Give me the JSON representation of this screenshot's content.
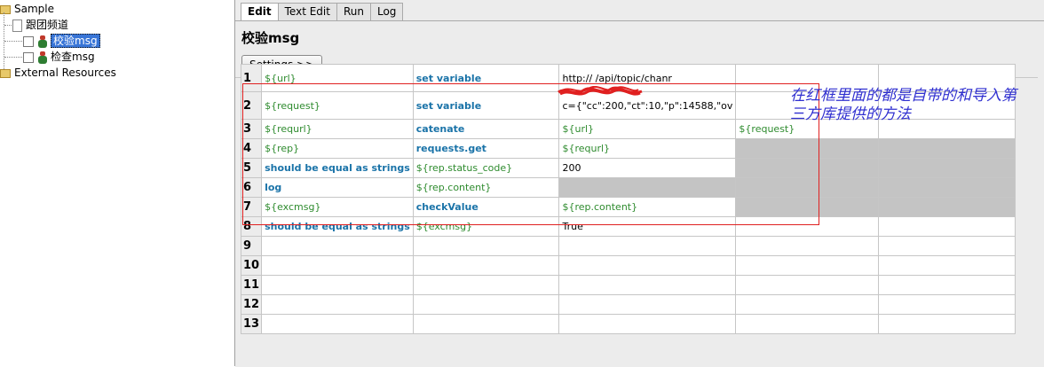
{
  "tree": {
    "root_label": "Sample",
    "suite_label": "跟团频道",
    "test1_label": "校验msg",
    "test2_label": "检查msg",
    "resources_label": "External Resources"
  },
  "tabs": [
    "Edit",
    "Text Edit",
    "Run",
    "Log"
  ],
  "page_title": "校验msg",
  "settings_label": "Settings >>",
  "annotation": "在红框里面的都是自带的和导入第三方库提供的方法",
  "rows": [
    {
      "n": "1",
      "c1": "${url}",
      "c2": "set variable",
      "c3": "http://          /api/topic/chanr",
      "c4": "",
      "c5": ""
    },
    {
      "n": "2",
      "c1": "${request}",
      "c2": "set variable",
      "c3": "c={\"cc\":200,\"ct\":10,\"p\":14588,\"ov",
      "c4": "",
      "c5": ""
    },
    {
      "n": "3",
      "c1": "${requrl}",
      "c2": "catenate",
      "c3": "${url}",
      "c4": "${request}",
      "c5": ""
    },
    {
      "n": "4",
      "c1": "${rep}",
      "c2": "requests.get",
      "c3": "${requrl}",
      "c4": "",
      "c5": ""
    },
    {
      "n": "5",
      "c1": "should be equal as strings",
      "c2": "${rep.status_code}",
      "c3": "200",
      "c4": "",
      "c5": ""
    },
    {
      "n": "6",
      "c1": "log",
      "c2": "${rep.content}",
      "c3": "",
      "c4": "",
      "c5": ""
    },
    {
      "n": "7",
      "c1": "${excmsg}",
      "c2": "checkValue",
      "c3": "${rep.content}",
      "c4": "",
      "c5": ""
    },
    {
      "n": "8",
      "c1": "should be equal as strings",
      "c2": "${excmsg}",
      "c3": "True",
      "c4": "",
      "c5": ""
    },
    {
      "n": "9",
      "c1": "",
      "c2": "",
      "c3": "",
      "c4": "",
      "c5": ""
    },
    {
      "n": "10",
      "c1": "",
      "c2": "",
      "c3": "",
      "c4": "",
      "c5": ""
    },
    {
      "n": "11",
      "c1": "",
      "c2": "",
      "c3": "",
      "c4": "",
      "c5": ""
    },
    {
      "n": "12",
      "c1": "",
      "c2": "",
      "c3": "",
      "c4": "",
      "c5": ""
    },
    {
      "n": "13",
      "c1": "",
      "c2": "",
      "c3": "",
      "c4": "",
      "c5": ""
    }
  ]
}
